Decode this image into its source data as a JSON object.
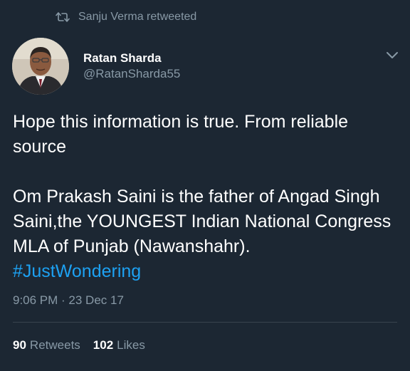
{
  "retweet": {
    "icon": "retweet-icon",
    "text": "Sanju Verma retweeted"
  },
  "author": {
    "name": "Ratan Sharda",
    "handle": "@RatanSharda55",
    "avatar_icon": "avatar-photo"
  },
  "menu": {
    "icon": "chevron-down-icon"
  },
  "tweet": {
    "line1": "Hope this information is true. From reliable source",
    "line2": "Om Prakash Saini is the father of Angad Singh Saini,the YOUNGEST Indian National Congress MLA of Punjab (Nawanshahr).",
    "hashtag": "#JustWondering"
  },
  "timestamp": "9:06 PM · 23 Dec 17",
  "stats": {
    "retweets_count": "90",
    "retweets_label": "Retweets",
    "likes_count": "102",
    "likes_label": "Likes"
  },
  "colors": {
    "background": "#1c2733",
    "secondary_text": "#8899a6",
    "link": "#1da1f2",
    "divider": "#38444d"
  }
}
